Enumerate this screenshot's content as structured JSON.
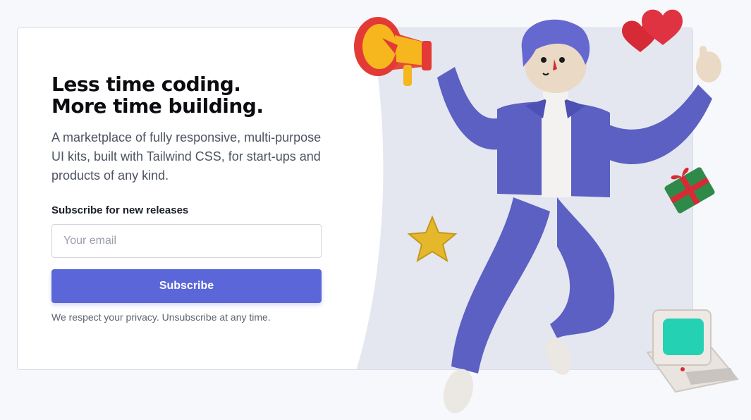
{
  "hero": {
    "headline_line1": "Less time coding.",
    "headline_line2": "More time building.",
    "description": "A marketplace of fully responsive, multi-purpose UI kits, built with Tailwind CSS, for start-ups and products of any kind."
  },
  "subscribe": {
    "label": "Subscribe for new releases",
    "email_placeholder": "Your email",
    "email_value": "",
    "button_label": "Subscribe",
    "privacy_note": "We respect your privacy. Unsubscribe at any time."
  },
  "illustration": {
    "items": [
      "megaphone-icon",
      "hearts-icon",
      "star-icon",
      "gift-icon",
      "computer-icon",
      "jumping-person"
    ]
  },
  "colors": {
    "accent": "#5b67d8",
    "page_background": "#f7f8fb",
    "panel_background": "#e4e7f0",
    "headline": "#0b0c10",
    "body_text": "#4d5461"
  }
}
